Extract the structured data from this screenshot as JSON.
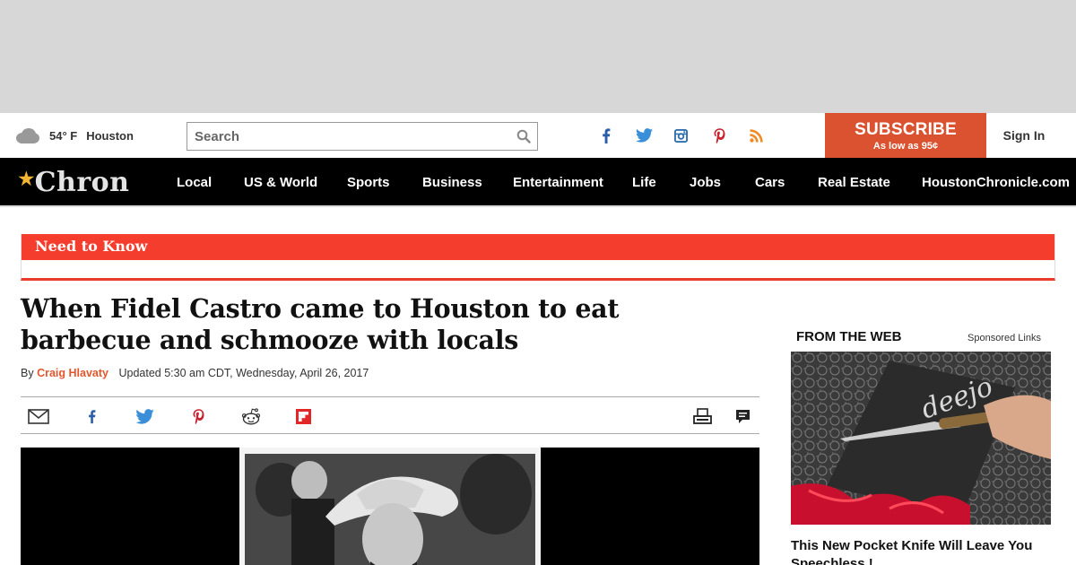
{
  "colors": {
    "brand_orange": "#da5230",
    "need_to_know_red": "#f53d2d",
    "navbar_bg": "#000000",
    "ad_placeholder": "#d7d7d7",
    "author_link": "#e4572e"
  },
  "weather": {
    "icon": "cloud-icon",
    "temperature": "54° F",
    "city": "Houston"
  },
  "search": {
    "placeholder": "Search",
    "icon": "search-icon"
  },
  "social_header": [
    "facebook-icon",
    "twitter-icon",
    "instagram-icon",
    "pinterest-icon",
    "rss-icon"
  ],
  "subscribe": {
    "label": "SUBSCRIBE",
    "sublabel": "As low as 95¢"
  },
  "signin": {
    "label": "Sign In"
  },
  "logo": {
    "text": "Chron",
    "icon": "star-icon"
  },
  "nav": {
    "items": [
      "Local",
      "US & World",
      "Sports",
      "Business",
      "Entertainment",
      "Life",
      "Jobs",
      "Cars",
      "Real Estate",
      "HoustonChronicle.com"
    ]
  },
  "need_to_know": {
    "label": "Need to Know"
  },
  "article": {
    "title": "When Fidel Castro came to Houston to eat barbecue and schmooze with locals",
    "by_prefix": "By",
    "author": "Craig Hlavaty",
    "updated": "Updated 5:30 am CDT, Wednesday, April 26, 2017",
    "share_icons": [
      "email-icon",
      "facebook-icon",
      "twitter-icon",
      "pinterest-icon",
      "reddit-icon",
      "flipboard-icon"
    ],
    "tool_icons": [
      "print-icon",
      "comments-icon"
    ]
  },
  "sidebar": {
    "heading": "FROM THE WEB",
    "sponsored": "Sponsored Links",
    "ad": {
      "image_text": "deejo",
      "title": "This New Pocket Knife Will Leave You Speechless !"
    }
  }
}
